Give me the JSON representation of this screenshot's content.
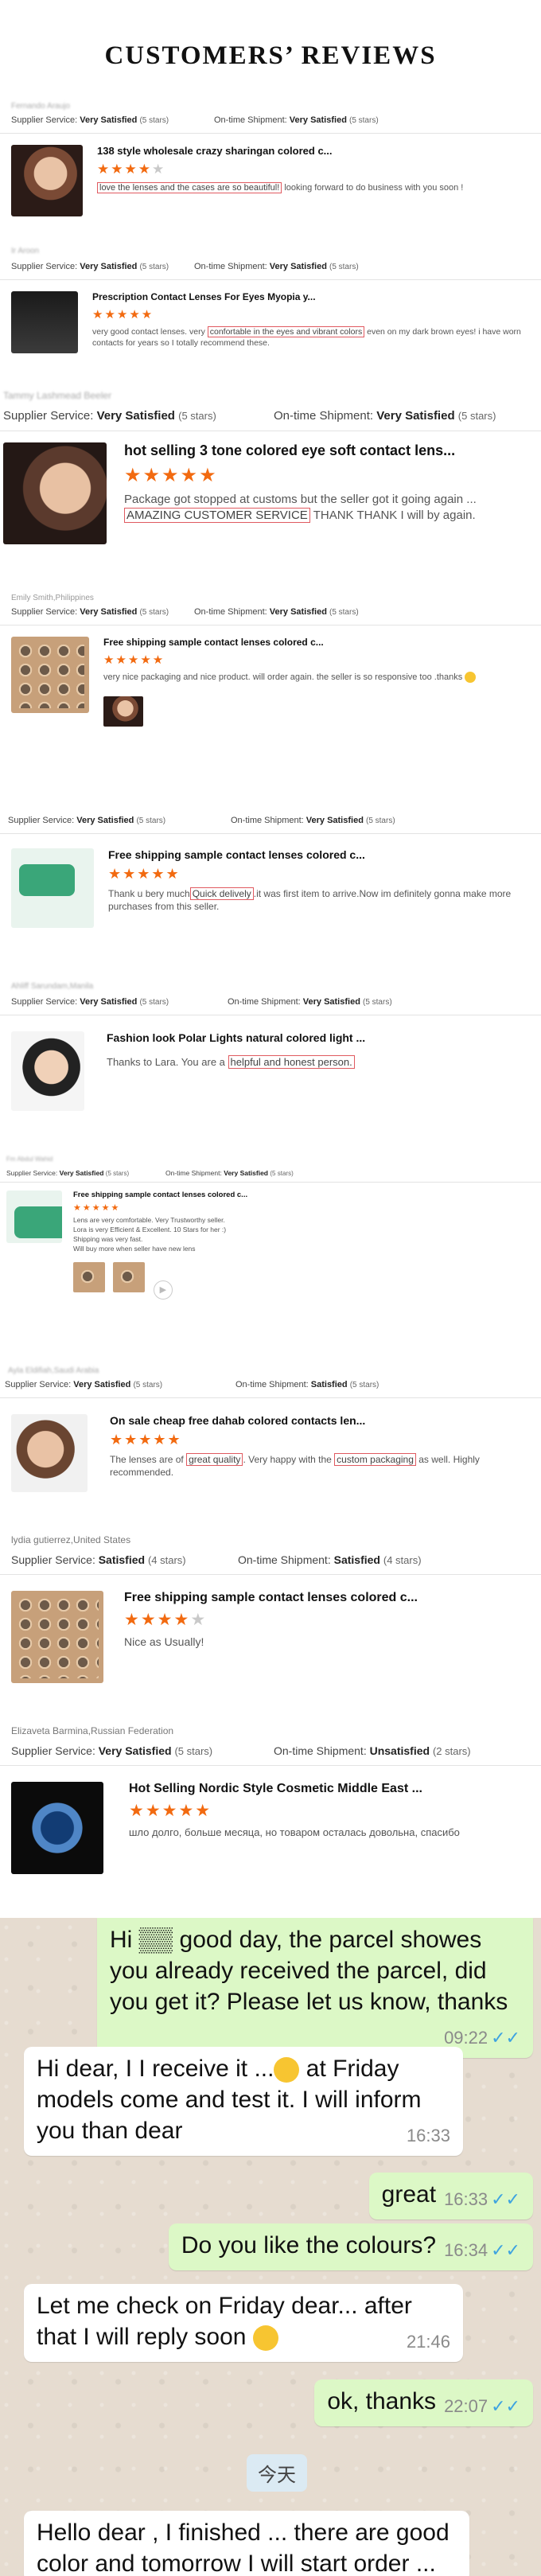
{
  "header": {
    "title": "CUSTOMERS’  REVIEWS"
  },
  "labels": {
    "supplier": "Supplier Service:",
    "shipment": "On-time Shipment:"
  },
  "reviews": [
    {
      "buyer": "Fernando Araujo",
      "supplier_rating": "Very Satisfied",
      "supplier_stars": "(5 stars)",
      "shipment_rating": "Very Satisfied",
      "shipment_stars": "(5 stars)",
      "product": "138 style wholesale crazy sharingan colored c...",
      "text_hl": "love the lenses and the cases are so beautiful!",
      "text_rest": " looking forward to do business with you soon !"
    },
    {
      "buyer": "Ir Aroon",
      "supplier_rating": "Very Satisfied",
      "supplier_stars": "(5 stars)",
      "shipment_rating": "Very Satisfied",
      "shipment_stars": "(5 stars)",
      "product": "Prescription Contact Lenses For Eyes Myopia y...",
      "text_pre": "very good contact lenses. very ",
      "text_hl": "confortable in the eyes and vibrant colors",
      "text_rest": " even on my dark brown eyes! i have worn contacts for years so I totally recommend these."
    },
    {
      "buyer": "Tammy Lashmead Beeler",
      "supplier_rating": "Very Satisfied",
      "supplier_stars": "(5 stars)",
      "shipment_rating": "Very Satisfied",
      "shipment_stars": "(5 stars)",
      "product": "hot selling 3 tone colored eye soft contact lens...",
      "text_pre": "Package got stopped at customs but the seller got it going again ...",
      "text_hl": "AMAZING CUSTOMER SERVICE",
      "text_rest": " THANK THANK I will by again."
    },
    {
      "buyer": "Emily Smith,Philippines",
      "supplier_rating": "Very Satisfied",
      "supplier_stars": "(5 stars)",
      "shipment_rating": "Very Satisfied",
      "shipment_stars": "(5 stars)",
      "product": "Free shipping sample contact lenses colored c...",
      "text_rest": "very nice packaging and nice product. will order again. the seller is so responsive too .thanks"
    },
    {
      "supplier_rating": "Very Satisfied",
      "supplier_stars": "(5 stars)",
      "shipment_rating": "Very Satisfied",
      "shipment_stars": "(5 stars)",
      "product": "Free shipping sample contact lenses colored c...",
      "text_pre": "Thank u bery much",
      "text_hl": "Quick delively",
      "text_rest": ".it was first item to arrive.Now im definitely gonna make more purchases from this seller."
    },
    {
      "buyer": "Ahliff Sarundam,Manila",
      "supplier_rating": "Very Satisfied",
      "supplier_stars": "(5 stars)",
      "shipment_rating": "Very Satisfied",
      "shipment_stars": "(5 stars)",
      "product": "Fashion look Polar Lights natural colored light ...",
      "text_pre": "Thanks to Lara.  You are a ",
      "text_hl": "helpful and honest person.",
      "text_rest": ""
    },
    {
      "buyer": "Fm Abdul Wahid",
      "supplier_rating": "Very Satisfied",
      "supplier_stars": "(5 stars)",
      "shipment_rating": "Very Satisfied",
      "shipment_stars": "(5 stars)",
      "product": "Free shipping sample contact lenses colored c...",
      "text_lines": [
        "Lens are very comfortable.  Very Trustworthy seller.",
        "Lora is very Efficient & Excellent.  10 Stars for her :)",
        "Shipping was very fast.",
        "Will buy more when seller have new lens"
      ]
    },
    {
      "buyer": "Ayla Eldifiah,Saudi Arabia",
      "supplier_rating": "Very Satisfied",
      "supplier_stars": "(5 stars)",
      "shipment_rating": "Satisfied",
      "shipment_stars": "(5 stars)",
      "product": "On sale cheap free dahab colored contacts len...",
      "text_pre": "The lenses are of ",
      "text_hl": "great quality",
      "text_mid": ". Very happy with the ",
      "text_hl2": "custom packaging",
      "text_rest": " as well. Highly recommended."
    },
    {
      "buyer": "lydia gutierrez,United States",
      "supplier_rating": "Satisfied",
      "supplier_stars": "(4 stars)",
      "shipment_rating": "Satisfied",
      "shipment_stars": "(4 stars)",
      "product": "Free shipping sample contact lenses colored c...",
      "text_rest": "Nice as Usually!"
    },
    {
      "buyer": "Elizaveta Barmina,Russian Federation",
      "supplier_rating": "Very Satisfied",
      "supplier_stars": "(5 stars)",
      "shipment_rating": "Unsatisfied",
      "shipment_stars": "(2 stars)",
      "product": "Hot Selling Nordic Style Cosmetic Middle East ...",
      "text_rest": "шло долго, больше месяца, но товаром осталась довольна, спасибо"
    }
  ],
  "chat": {
    "m1": {
      "text": "Hi ▒▒ good day, the parcel showes you already received the parcel, did you get it? Please let us know, thanks",
      "time": "09:22"
    },
    "m2": {
      "text1": "Hi dear, I I receive it ...",
      "text2": " at Friday models come and test it. I will inform you than dear",
      "time": "16:33"
    },
    "m3": {
      "text": "great",
      "time": "16:33"
    },
    "m4": {
      "text": "Do you like the colours?",
      "time": "16:34"
    },
    "m5": {
      "text": "Let me check on Friday dear... after that I will reply soon",
      "time": "21:46"
    },
    "m6": {
      "text": "ok, thanks",
      "time": "22:07"
    },
    "day": "今天",
    "m7": {
      "text": "Hello dear , I finished ... there are good color and tomorrow I will start order ..."
    },
    "ticks": "✓✓"
  },
  "colors": {
    "star": "#f26a10",
    "highlight_border": "#e05a60",
    "chat_out": "#dcf8c6",
    "tick": "#3ea3e0"
  }
}
